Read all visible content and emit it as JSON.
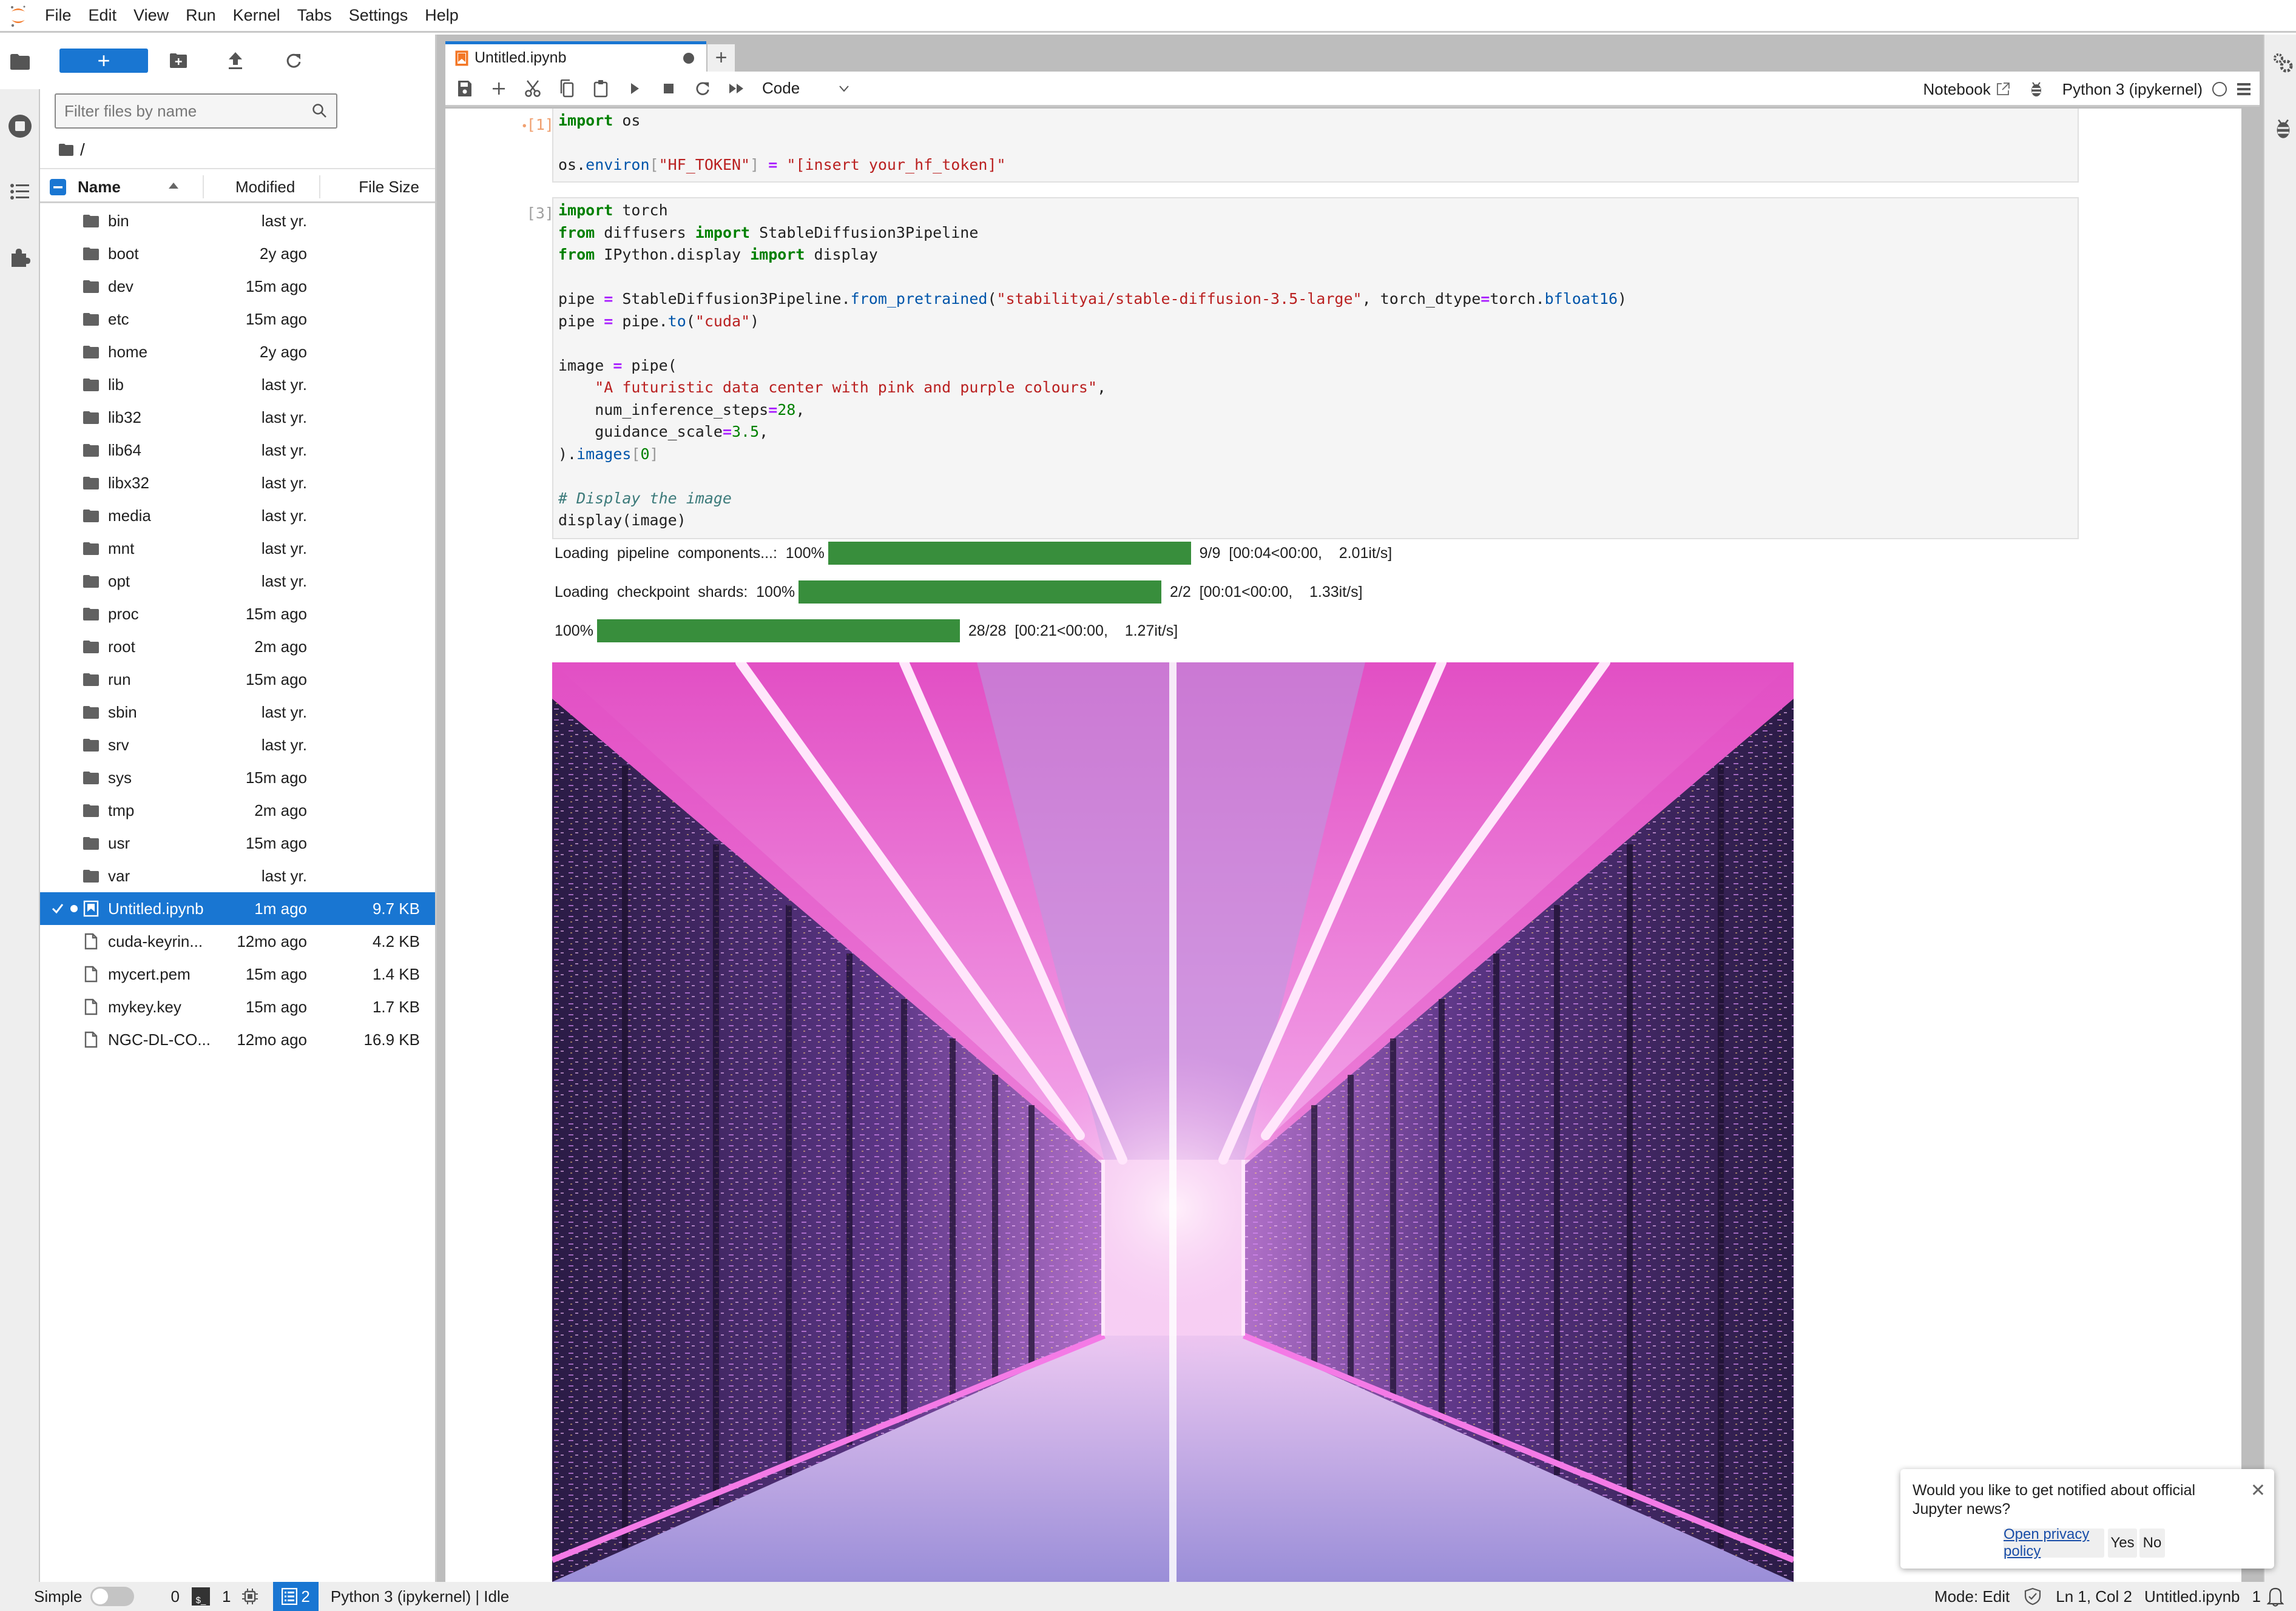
{
  "menubar": {
    "items": [
      "File",
      "Edit",
      "View",
      "Run",
      "Kernel",
      "Tabs",
      "Settings",
      "Help"
    ]
  },
  "left_rail": {
    "icons": [
      "folder-icon",
      "running-sessions-icon",
      "table-of-contents-icon",
      "extensions-icon"
    ]
  },
  "file_browser": {
    "new_button_label": "+",
    "filter_placeholder": "Filter files by name",
    "breadcrumb": "/",
    "columns": {
      "name": "Name",
      "modified": "Modified",
      "size": "File Size"
    },
    "rows": [
      {
        "name": "bin",
        "modified": "last yr.",
        "size": "",
        "type": "folder"
      },
      {
        "name": "boot",
        "modified": "2y ago",
        "size": "",
        "type": "folder"
      },
      {
        "name": "dev",
        "modified": "15m ago",
        "size": "",
        "type": "folder"
      },
      {
        "name": "etc",
        "modified": "15m ago",
        "size": "",
        "type": "folder"
      },
      {
        "name": "home",
        "modified": "2y ago",
        "size": "",
        "type": "folder"
      },
      {
        "name": "lib",
        "modified": "last yr.",
        "size": "",
        "type": "folder"
      },
      {
        "name": "lib32",
        "modified": "last yr.",
        "size": "",
        "type": "folder"
      },
      {
        "name": "lib64",
        "modified": "last yr.",
        "size": "",
        "type": "folder"
      },
      {
        "name": "libx32",
        "modified": "last yr.",
        "size": "",
        "type": "folder"
      },
      {
        "name": "media",
        "modified": "last yr.",
        "size": "",
        "type": "folder"
      },
      {
        "name": "mnt",
        "modified": "last yr.",
        "size": "",
        "type": "folder"
      },
      {
        "name": "opt",
        "modified": "last yr.",
        "size": "",
        "type": "folder"
      },
      {
        "name": "proc",
        "modified": "15m ago",
        "size": "",
        "type": "folder"
      },
      {
        "name": "root",
        "modified": "2m ago",
        "size": "",
        "type": "folder"
      },
      {
        "name": "run",
        "modified": "15m ago",
        "size": "",
        "type": "folder"
      },
      {
        "name": "sbin",
        "modified": "last yr.",
        "size": "",
        "type": "folder"
      },
      {
        "name": "srv",
        "modified": "last yr.",
        "size": "",
        "type": "folder"
      },
      {
        "name": "sys",
        "modified": "15m ago",
        "size": "",
        "type": "folder"
      },
      {
        "name": "tmp",
        "modified": "2m ago",
        "size": "",
        "type": "folder"
      },
      {
        "name": "usr",
        "modified": "15m ago",
        "size": "",
        "type": "folder"
      },
      {
        "name": "var",
        "modified": "last yr.",
        "size": "",
        "type": "folder"
      },
      {
        "name": "Untitled.ipynb",
        "modified": "1m ago",
        "size": "9.7 KB",
        "type": "notebook",
        "selected": true,
        "running": true
      },
      {
        "name": "cuda-keyrin...",
        "modified": "12mo ago",
        "size": "4.2 KB",
        "type": "file"
      },
      {
        "name": "mycert.pem",
        "modified": "15m ago",
        "size": "1.4 KB",
        "type": "file"
      },
      {
        "name": "mykey.key",
        "modified": "15m ago",
        "size": "1.7 KB",
        "type": "file"
      },
      {
        "name": "NGC-DL-CO...",
        "modified": "12mo ago",
        "size": "16.9 KB",
        "type": "file"
      }
    ]
  },
  "tab": {
    "label": "Untitled.ipynb",
    "unsaved": true,
    "add_label": "+"
  },
  "toolbar": {
    "cell_type": "Code",
    "notebook_label": "Notebook",
    "kernel_label": "Python 3 (ipykernel)"
  },
  "cells": [
    {
      "prompt": "[1]:",
      "lines": [
        [
          [
            "kw",
            "import"
          ],
          [
            "t",
            " os"
          ]
        ],
        [
          [
            "t",
            ""
          ]
        ],
        [
          [
            "t",
            "os"
          ],
          [
            "t",
            "."
          ],
          [
            "fn",
            "environ"
          ],
          [
            "br",
            "["
          ],
          [
            "str",
            "\"HF_TOKEN\""
          ],
          [
            "br",
            "]"
          ],
          [
            "t",
            " "
          ],
          [
            "op",
            "="
          ],
          [
            "t",
            " "
          ],
          [
            "str",
            "\"[insert your_hf_token]\""
          ]
        ]
      ]
    },
    {
      "prompt": "[3]:",
      "lines": [
        [
          [
            "kw",
            "import"
          ],
          [
            "t",
            " torch"
          ]
        ],
        [
          [
            "kw",
            "from"
          ],
          [
            "t",
            " diffusers "
          ],
          [
            "kw",
            "import"
          ],
          [
            "t",
            " StableDiffusion3Pipeline"
          ]
        ],
        [
          [
            "kw",
            "from"
          ],
          [
            "t",
            " IPython.display "
          ],
          [
            "kw",
            "import"
          ],
          [
            "t",
            " display"
          ]
        ],
        [
          [
            "t",
            ""
          ]
        ],
        [
          [
            "t",
            "pipe "
          ],
          [
            "op",
            "="
          ],
          [
            "t",
            " StableDiffusion3Pipeline."
          ],
          [
            "fn",
            "from_pretrained"
          ],
          [
            "t",
            "("
          ],
          [
            "str",
            "\"stabilityai/stable-diffusion-3.5-large\""
          ],
          [
            "t",
            ", torch_dtype"
          ],
          [
            "op",
            "="
          ],
          [
            "t",
            "torch."
          ],
          [
            "fn",
            "bfloat16"
          ],
          [
            "t",
            ")"
          ]
        ],
        [
          [
            "t",
            "pipe "
          ],
          [
            "op",
            "="
          ],
          [
            "t",
            " pipe."
          ],
          [
            "fn",
            "to"
          ],
          [
            "t",
            "("
          ],
          [
            "str",
            "\"cuda\""
          ],
          [
            "t",
            ")"
          ]
        ],
        [
          [
            "t",
            ""
          ]
        ],
        [
          [
            "t",
            "image "
          ],
          [
            "op",
            "="
          ],
          [
            "t",
            " pipe("
          ]
        ],
        [
          [
            "t",
            "    "
          ],
          [
            "str",
            "\"A futuristic data center with pink and purple colours\""
          ],
          [
            "t",
            ","
          ]
        ],
        [
          [
            "t",
            "    num_inference_steps"
          ],
          [
            "op",
            "="
          ],
          [
            "num",
            "28"
          ],
          [
            "t",
            ","
          ]
        ],
        [
          [
            "t",
            "    guidance_scale"
          ],
          [
            "op",
            "="
          ],
          [
            "num",
            "3.5"
          ],
          [
            "t",
            ","
          ]
        ],
        [
          [
            "t",
            ")."
          ],
          [
            "fn",
            "images"
          ],
          [
            "br",
            "["
          ],
          [
            "num",
            "0"
          ],
          [
            "br",
            "]"
          ]
        ],
        [
          [
            "t",
            ""
          ]
        ],
        [
          [
            "cm",
            "# Display the image"
          ]
        ],
        [
          [
            "t",
            "display(image)"
          ]
        ]
      ]
    }
  ],
  "outputs": {
    "progress": [
      {
        "label": "Loading  pipeline  components...:  100%",
        "percent": 100,
        "stats": "  9/9  [00:04<00:00,    2.01it/s]"
      },
      {
        "label": "Loading  checkpoint  shards:  100%",
        "percent": 100,
        "stats": "  2/2  [00:01<00:00,    1.33it/s]"
      },
      {
        "label": "100%",
        "percent": 100,
        "stats": "  28/28  [00:21<00:00,    1.27it/s]"
      }
    ],
    "image_alt": "A futuristic data center with pink and purple colours"
  },
  "statusbar": {
    "simple_label": "Simple",
    "terminals_count": "0",
    "kernels_count": "1",
    "active_notebooks": "2",
    "kernel_status": "Python 3 (ipykernel) | Idle",
    "mode": "Mode: Edit",
    "cursor": "Ln 1, Col 2",
    "filename": "Untitled.ipynb",
    "notifications_count": "1"
  },
  "notification": {
    "message": "Would you like to get notified about official Jupyter news?",
    "privacy_link": "Open privacy policy",
    "yes_label": "Yes",
    "no_label": "No"
  },
  "colors": {
    "accent": "#1976d2",
    "progress": "#388e3c",
    "logo_orange": "#f37726"
  }
}
